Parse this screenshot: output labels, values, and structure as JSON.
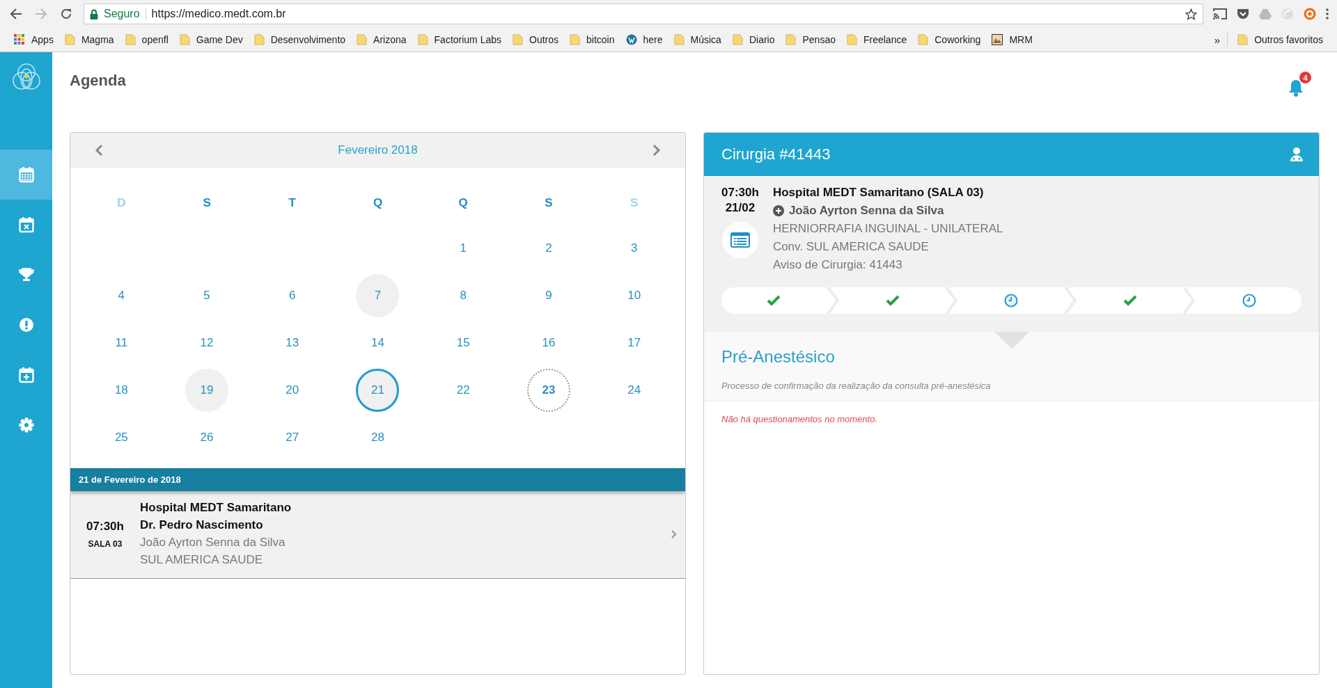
{
  "browser": {
    "secure_label": "Seguro",
    "url": "https://medico.medt.com.br",
    "bookmarks": [
      {
        "kind": "apps",
        "label": "Apps"
      },
      {
        "kind": "folder",
        "label": "Magma"
      },
      {
        "kind": "folder",
        "label": "openfl"
      },
      {
        "kind": "folder",
        "label": "Game Dev"
      },
      {
        "kind": "folder",
        "label": "Desenvolvimento"
      },
      {
        "kind": "folder",
        "label": "Arizona"
      },
      {
        "kind": "folder",
        "label": "Factorium Labs"
      },
      {
        "kind": "folder",
        "label": "Outros"
      },
      {
        "kind": "folder",
        "label": "bitcoin"
      },
      {
        "kind": "wordpress",
        "label": "here"
      },
      {
        "kind": "folder",
        "label": "Música"
      },
      {
        "kind": "folder",
        "label": "Diario"
      },
      {
        "kind": "folder",
        "label": "Pensao"
      },
      {
        "kind": "folder",
        "label": "Freelance"
      },
      {
        "kind": "folder",
        "label": "Coworking"
      },
      {
        "kind": "image",
        "label": "MRM"
      }
    ],
    "overflow": "»",
    "other_bookmarks": "Outros favoritos"
  },
  "sidebar": {
    "items": [
      {
        "selected": true
      },
      {
        "selected": false
      },
      {
        "selected": false
      },
      {
        "selected": false
      },
      {
        "selected": false
      },
      {
        "selected": false
      }
    ]
  },
  "header": {
    "title": "Agenda",
    "notification_count": "4"
  },
  "calendar": {
    "month": "Fevereiro 2018",
    "weekdays": [
      {
        "label": "D",
        "muted": true
      },
      {
        "label": "S",
        "muted": false
      },
      {
        "label": "T",
        "muted": false
      },
      {
        "label": "Q",
        "muted": false
      },
      {
        "label": "Q",
        "muted": false
      },
      {
        "label": "S",
        "muted": false
      },
      {
        "label": "S",
        "muted": true
      }
    ],
    "weeks": [
      [
        {
          "kind": "empty"
        },
        {
          "kind": "empty"
        },
        {
          "kind": "empty"
        },
        {
          "kind": "empty"
        },
        {
          "day": "1",
          "selected": false,
          "kind": "plain"
        },
        {
          "day": "2",
          "selected": false,
          "kind": "plain"
        },
        {
          "day": "3",
          "selected": false,
          "kind": "plain"
        }
      ],
      [
        {
          "day": "4",
          "selected": false,
          "kind": "plain"
        },
        {
          "day": "5",
          "selected": false,
          "kind": "plain"
        },
        {
          "day": "6",
          "selected": false,
          "kind": "plain"
        },
        {
          "day": "7",
          "selected": false,
          "kind": "event"
        },
        {
          "day": "8",
          "selected": false,
          "kind": "plain"
        },
        {
          "day": "9",
          "selected": false,
          "kind": "plain"
        },
        {
          "day": "10",
          "selected": false,
          "kind": "plain"
        }
      ],
      [
        {
          "day": "11",
          "selected": false,
          "kind": "plain"
        },
        {
          "day": "12",
          "selected": false,
          "kind": "plain"
        },
        {
          "day": "13",
          "selected": false,
          "kind": "plain"
        },
        {
          "day": "14",
          "selected": false,
          "kind": "plain"
        },
        {
          "day": "15",
          "selected": false,
          "kind": "plain"
        },
        {
          "day": "16",
          "selected": false,
          "kind": "plain"
        },
        {
          "day": "17",
          "selected": false,
          "kind": "plain"
        }
      ],
      [
        {
          "day": "18",
          "selected": false,
          "kind": "plain"
        },
        {
          "day": "19",
          "selected": false,
          "kind": "event"
        },
        {
          "day": "20",
          "selected": false,
          "kind": "plain"
        },
        {
          "day": "21",
          "selected": true,
          "kind": "event"
        },
        {
          "day": "22",
          "selected": false,
          "kind": "plain"
        },
        {
          "day": "23",
          "selected": false,
          "kind": "today"
        },
        {
          "day": "24",
          "selected": false,
          "kind": "plain"
        }
      ],
      [
        {
          "day": "25",
          "selected": false,
          "kind": "plain"
        },
        {
          "day": "26",
          "selected": false,
          "kind": "plain"
        },
        {
          "day": "27",
          "selected": false,
          "kind": "plain"
        },
        {
          "day": "28",
          "selected": false,
          "kind": "plain"
        },
        {
          "kind": "empty"
        },
        {
          "kind": "empty"
        },
        {
          "kind": "empty"
        }
      ]
    ],
    "selected_date_label": "21 de Fevereiro de 2018",
    "appointments": [
      {
        "time": "07:30h",
        "room": "SALA 03",
        "hospital": "Hospital MEDT Samaritano",
        "doctor": "Dr. Pedro Nascimento",
        "patient": "João Ayrton Senna da Silva",
        "insurance": "SUL AMERICA SAUDE"
      }
    ]
  },
  "surgery": {
    "title": "Cirurgia #41443",
    "time": "07:30h",
    "date": "21/02",
    "hospital": "Hospital MEDT Samaritano (SALA 03)",
    "patient": "João Ayrton Senna da Silva",
    "procedure": "HERNIORRAFIA INGUINAL - UNILATERAL",
    "insurance": "Conv. SUL AMERICA SAUDE",
    "notice": "Aviso de Cirurgia: 41443",
    "steps": [
      {
        "kind": "done",
        "selected": false
      },
      {
        "kind": "done",
        "selected": false
      },
      {
        "kind": "pending",
        "selected": true
      },
      {
        "kind": "done",
        "selected": false
      },
      {
        "kind": "pending",
        "selected": false
      }
    ],
    "section_title": "Pré-Anestésico",
    "section_description": "Processo de confirmação da realização da consulta pré-anestésica",
    "empty_message": "Não há questionamentos no momento."
  }
}
